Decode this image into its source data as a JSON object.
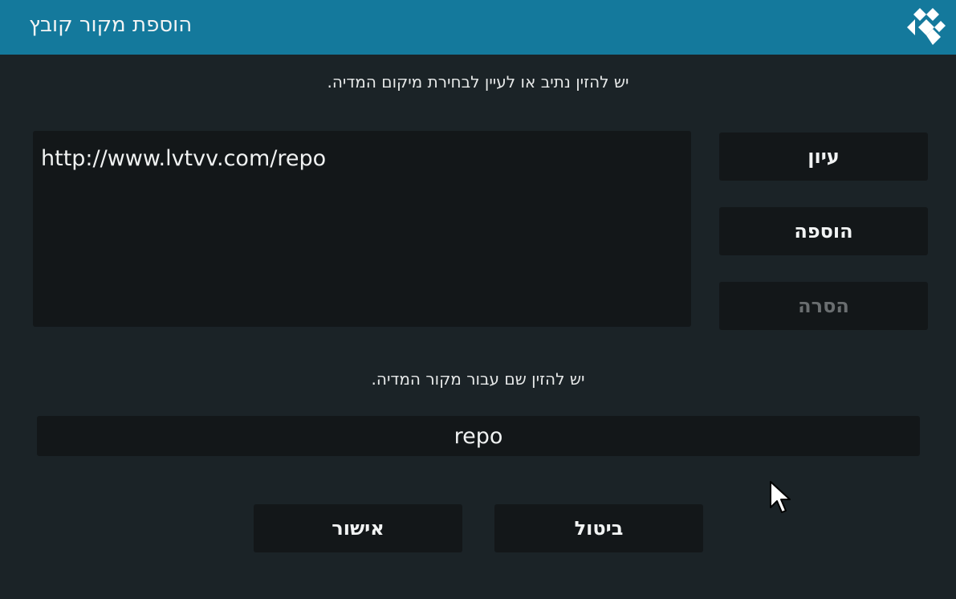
{
  "header": {
    "title": "הוספת מקור קובץ",
    "logo_icon": "kodi-logo-icon"
  },
  "path_section": {
    "prompt": "יש להזין נתיב או לעיין לבחירת מיקום המדיה.",
    "paths": [
      "http://www.lvtvv.com/repo"
    ]
  },
  "side_buttons": {
    "browse_label": "עיון",
    "add_label": "הוספה",
    "remove_label": "הסרה"
  },
  "name_section": {
    "prompt": "יש להזין שם עבור מקור המדיה.",
    "value": "repo"
  },
  "dialog_buttons": {
    "ok_label": "אישור",
    "cancel_label": "ביטול"
  },
  "colors": {
    "header_bg": "#14799c",
    "body_bg": "#1b2327",
    "control_bg": "#131719",
    "disabled_text": "#6a6e70"
  }
}
